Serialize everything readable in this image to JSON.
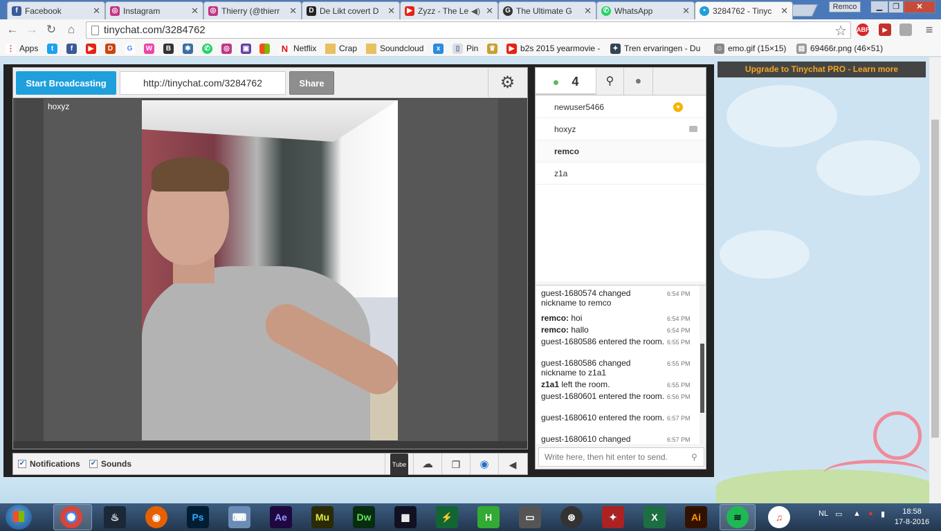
{
  "tabs": [
    {
      "label": "Facebook",
      "icon": "facebook-icon"
    },
    {
      "label": "Instagram",
      "icon": "instagram-icon"
    },
    {
      "label": "Thierry (@thierr",
      "icon": "instagram-icon"
    },
    {
      "label": "De Likt covert D",
      "icon": "d-icon"
    },
    {
      "label": "Zyzz - The Le",
      "icon": "youtube-icon"
    },
    {
      "label": "The Ultimate G",
      "icon": "g-icon"
    },
    {
      "label": "WhatsApp",
      "icon": "whatsapp-icon"
    },
    {
      "label": "3284762 - Tinyc",
      "icon": "tinychat-icon"
    }
  ],
  "window": {
    "profile": "Remco"
  },
  "address_bar": {
    "url": "tinychat.com/3284762"
  },
  "bookmarks": [
    {
      "label": "Apps",
      "icon": "apps-grid-icon"
    },
    {
      "label": "Netflix",
      "icon": "netflix-icon"
    },
    {
      "label": "Crap",
      "icon": "folder-icon"
    },
    {
      "label": "Soundcloud",
      "icon": "folder-icon"
    },
    {
      "label": "Pin",
      "icon": "pin-icon"
    },
    {
      "label": "b2s 2015 yearmovie -",
      "icon": "youtube-icon"
    },
    {
      "label": "Tren ervaringen - Du",
      "icon": "forum-icon"
    },
    {
      "label": "emo.gif (15×15)",
      "icon": "image-icon"
    },
    {
      "label": "69466r.png (46×51)",
      "icon": "image-icon"
    }
  ],
  "promo": {
    "text": "Upgrade to Tinychat PRO - Learn more"
  },
  "broadcast": {
    "start_label": "Start Broadcasting",
    "room_url": "http://tinychat.com/3284762",
    "share_label": "Share"
  },
  "video": {
    "username": "hoxyz"
  },
  "bottom_bar": {
    "notifications_label": "Notifications",
    "sounds_label": "Sounds"
  },
  "user_count": "4",
  "users": [
    {
      "name": "newuser5466",
      "badge": "mod"
    },
    {
      "name": "hoxyz",
      "badge": "camera"
    },
    {
      "name": "remco",
      "badge": ""
    },
    {
      "name": "z1a",
      "badge": ""
    }
  ],
  "messages": [
    {
      "text": "guest-1680574 changed nickname to remco",
      "time": "6:54 PM"
    },
    {
      "user": "remco:",
      "text": " hoi",
      "time": "6:54 PM"
    },
    {
      "user": "remco:",
      "text": " hallo",
      "time": "6:54 PM"
    },
    {
      "text": "guest-1680586 entered the room.",
      "time": "6:55 PM"
    },
    {
      "text": "guest-1680586 changed nickname to z1a1",
      "time": "6:55 PM"
    },
    {
      "user": "z1a1",
      "text": " left the room.",
      "time": "6:55 PM"
    },
    {
      "text": "guest-1680601 entered the room.",
      "time": "6:56 PM"
    },
    {
      "text": "guest-1680610 entered the room.",
      "time": "6:57 PM"
    },
    {
      "text": "guest-1680610 changed",
      "time": "6:57 PM"
    }
  ],
  "chat_input": {
    "placeholder": "Write here, then hit enter to send."
  },
  "taskbar": {
    "language": "NL",
    "time": "18:58",
    "date": "17-8-2016"
  }
}
